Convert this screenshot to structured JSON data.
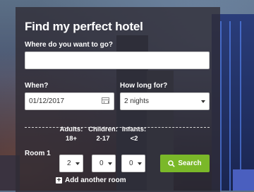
{
  "form": {
    "title": "Find my perfect hotel",
    "destination": {
      "label": "Where do you want to go?",
      "value": "",
      "placeholder": ""
    },
    "when": {
      "label": "When?",
      "value": "01/12/2017"
    },
    "duration": {
      "label": "How long for?",
      "value": "2 nights"
    },
    "guests": {
      "adults": {
        "label": "Adults:",
        "range": "18+",
        "value": "2"
      },
      "children": {
        "label": "Children:",
        "range": "2-17",
        "value": "0"
      },
      "infants": {
        "label": "Infants:",
        "range": "<2",
        "value": "0"
      }
    },
    "room_label": "Room 1",
    "search_label": "Search",
    "add_room_label": "Add another room"
  },
  "colors": {
    "search_button": "#7ab829",
    "panel": "#302c34"
  }
}
